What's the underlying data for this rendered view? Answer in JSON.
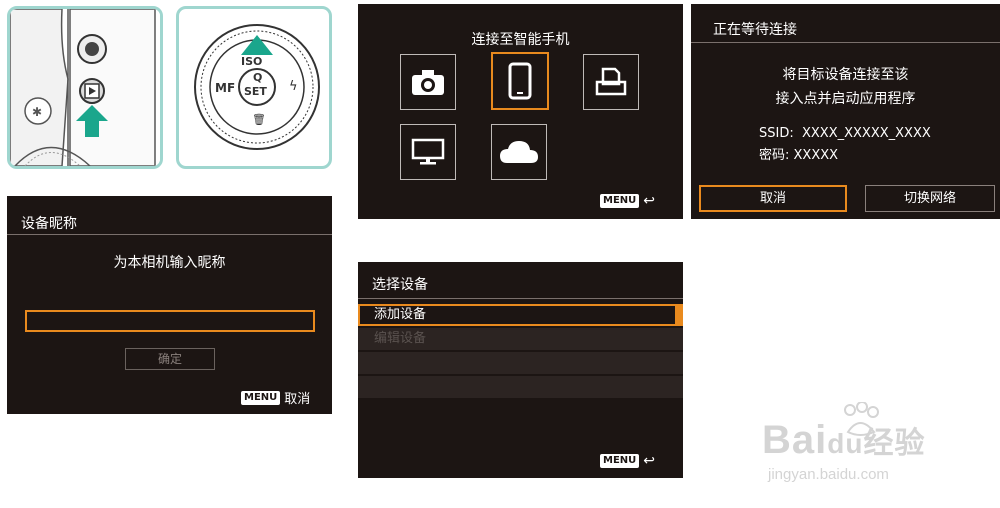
{
  "illustration": {
    "dial_labels": {
      "top": "ISO",
      "left": "MF",
      "center_top": "Q",
      "center_bottom": "SET"
    }
  },
  "screen_connect": {
    "title": "连接至智能手机",
    "tiles": [
      "camera-icon",
      "smartphone-icon",
      "printer-icon",
      "monitor-icon",
      "cloud-icon"
    ],
    "menu_key": "MENU",
    "menu_action": "↩"
  },
  "screen_waiting": {
    "title": "正在等待连接",
    "line1": "将目标设备连接至该",
    "line2": "接入点并启动应用程序",
    "ssid": "SSID:  XXXX_XXXXX_XXXX",
    "password": "密码: XXXXX",
    "cancel_label": "取消",
    "switch_label": "切换网络"
  },
  "screen_nickname": {
    "title": "设备昵称",
    "prompt": "为本相机输入昵称",
    "input_value": "",
    "ok_label": "确定",
    "menu_key": "MENU",
    "menu_action": "取消"
  },
  "screen_select": {
    "title": "选择设备",
    "items": [
      "添加设备",
      "编辑设备"
    ],
    "menu_key": "MENU",
    "menu_action": "↩"
  },
  "watermark": {
    "brand": "Bai",
    "brand2": "du",
    "product": "经验",
    "url": "jingyan.baidu.com"
  },
  "colors": {
    "screen_bg": "#1c1513",
    "highlight": "#e98a1e",
    "accent_arrow": "#1aa68c"
  }
}
